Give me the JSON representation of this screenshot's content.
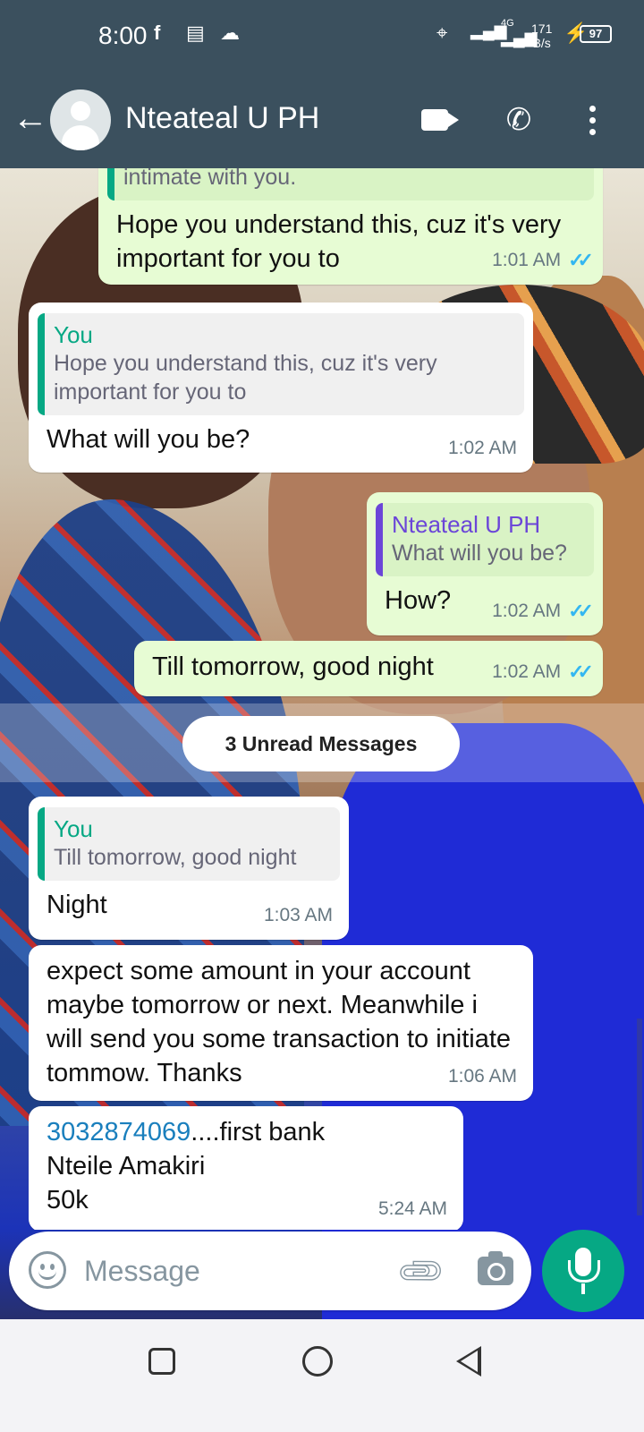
{
  "status_bar": {
    "time": "8:00",
    "network_type": "4G",
    "speed_value": "171",
    "speed_unit": "B/s",
    "battery": "97",
    "icons": [
      "facebook-icon",
      "sim-icon",
      "cloud-icon",
      "location-icon",
      "signal-icon",
      "signal-icon",
      "charging-icon"
    ]
  },
  "header": {
    "contact_name": "Nteateal U PH",
    "icons": [
      "back-arrow-icon",
      "avatar",
      "video-call-icon",
      "phone-icon",
      "more-options-icon"
    ]
  },
  "messages": [
    {
      "direction": "out",
      "quote": {
        "text": "intimate with you."
      },
      "text": "Hope you understand this, cuz it's very important for you to",
      "time": "1:01 AM",
      "read": true
    },
    {
      "direction": "in",
      "quote": {
        "author": "You",
        "text": "Hope you understand this, cuz it's very important for you to"
      },
      "text": "What will you be?",
      "time": "1:02 AM"
    },
    {
      "direction": "out",
      "quote": {
        "author": "Nteateal U PH",
        "text": "What will you be?"
      },
      "text": "How?",
      "time": "1:02 AM",
      "read": true
    },
    {
      "direction": "out",
      "text": "Till tomorrow, good night",
      "time": "1:02 AM",
      "read": true
    },
    {
      "direction": "in",
      "quote": {
        "author": "You",
        "text": "Till tomorrow, good night"
      },
      "text": "Night",
      "time": "1:03 AM"
    },
    {
      "direction": "in",
      "text": "expect some amount in your account maybe tomorrow or next. Meanwhile i will send you some transaction to initiate tommow.  Thanks",
      "time": "1:06 AM"
    },
    {
      "direction": "in",
      "link": "3032874069",
      "text_after_link": "....first bank",
      "line2": "Nteile Amakiri",
      "line3": "50k",
      "time": "5:24 AM"
    }
  ],
  "unread_label": "3 Unread Messages",
  "composer": {
    "placeholder": "Message",
    "value": "",
    "icons": [
      "emoji-icon",
      "attach-icon",
      "camera-icon",
      "mic-icon"
    ]
  },
  "colors": {
    "header": "#3b505e",
    "outgoing_bubble": "#e7fcd4",
    "incoming_bubble": "#ffffff",
    "accent": "#06a884",
    "read_ticks": "#34b7f1",
    "link": "#1a7fbd"
  }
}
